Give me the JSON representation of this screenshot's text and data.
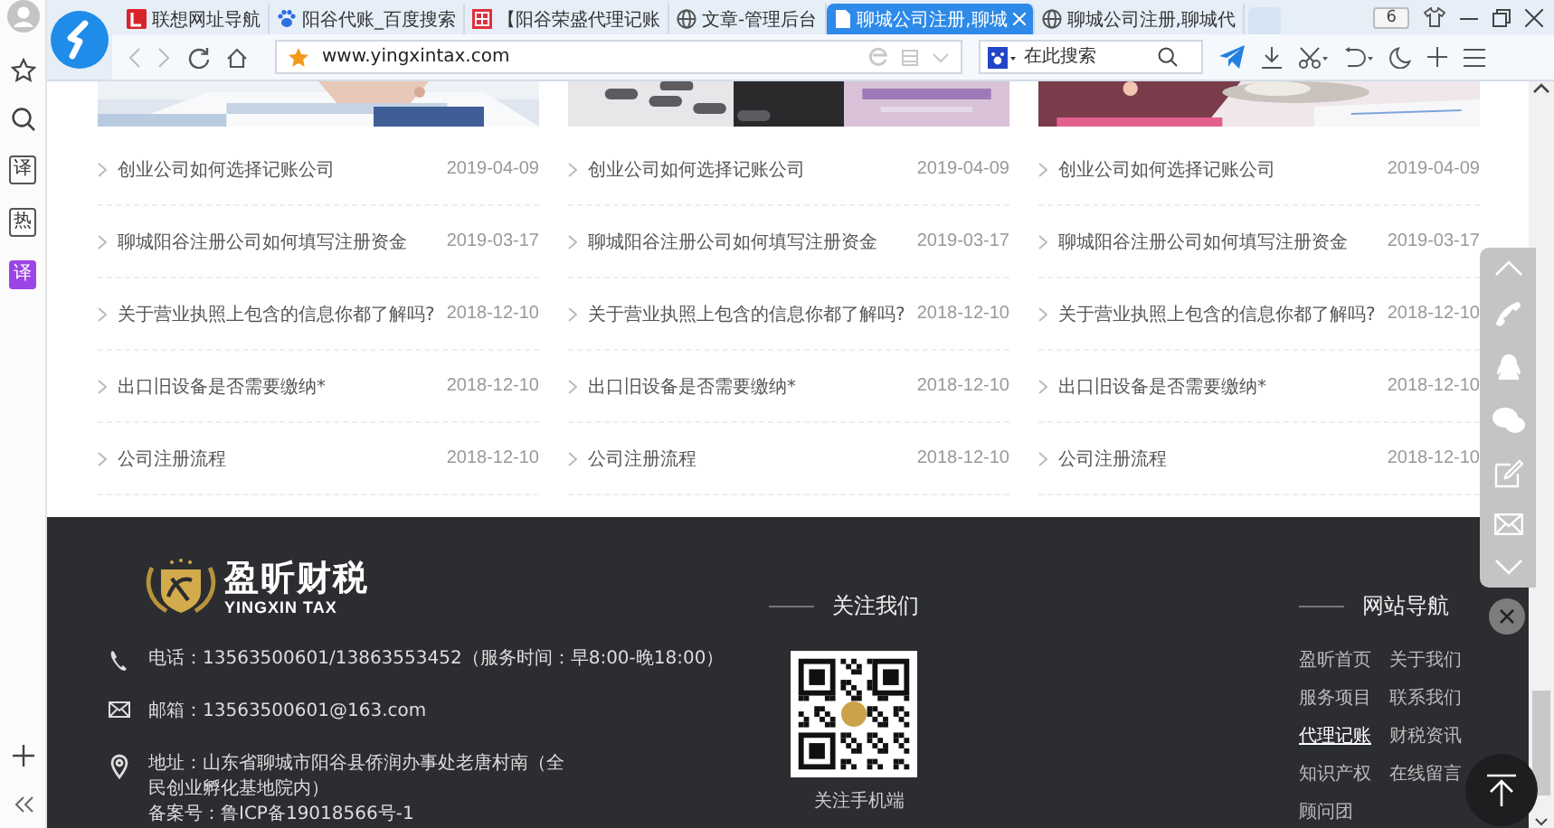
{
  "browser": {
    "tabs": [
      {
        "title": "联想网址导航",
        "kind": "red",
        "selected": false
      },
      {
        "title": "阳谷代账_百度搜索",
        "kind": "paw",
        "selected": false
      },
      {
        "title": "【阳谷荣盛代理记账",
        "kind": "grid",
        "selected": false
      },
      {
        "title": "文章-管理后台",
        "kind": "globe",
        "selected": false
      },
      {
        "title": "聊城公司注册,聊城",
        "kind": "page",
        "selected": true
      },
      {
        "title": "聊城公司注册,聊城代",
        "kind": "globe",
        "selected": false
      }
    ],
    "badge": "6",
    "url": "www.yingxintax.com",
    "search": {
      "placeholder": "在此搜索"
    }
  },
  "sidebar": {
    "tools": [
      {
        "kind": "star"
      },
      {
        "kind": "search"
      },
      {
        "kind": "glyph",
        "text": "译"
      },
      {
        "kind": "glyph",
        "text": "热"
      },
      {
        "kind": "glyph-filled",
        "text": "译"
      }
    ]
  },
  "news": {
    "columns": [
      {
        "image": {
          "kind": "picture"
        },
        "items": [
          {
            "title": "创业公司如何选择记账公司",
            "date": "2019-04-09"
          },
          {
            "title": "聊城阳谷注册公司如何填写注册资金",
            "date": "2019-03-17"
          },
          {
            "title": "关于营业执照上包含的信息你都了解吗?",
            "date": "2018-12-10"
          },
          {
            "title": "出口旧设备是否需要缴纳*",
            "date": "2018-12-10"
          },
          {
            "title": "公司注册流程",
            "date": "2018-12-10"
          }
        ]
      },
      {
        "image": {
          "kind": "picture"
        },
        "items": [
          {
            "title": "创业公司如何选择记账公司",
            "date": "2019-04-09"
          },
          {
            "title": "聊城阳谷注册公司如何填写注册资金",
            "date": "2019-03-17"
          },
          {
            "title": "关于营业执照上包含的信息你都了解吗?",
            "date": "2018-12-10"
          },
          {
            "title": "出口旧设备是否需要缴纳*",
            "date": "2018-12-10"
          },
          {
            "title": "公司注册流程",
            "date": "2018-12-10"
          }
        ]
      },
      {
        "image": {
          "kind": "picture"
        },
        "items": [
          {
            "title": "创业公司如何选择记账公司",
            "date": "2019-04-09"
          },
          {
            "title": "聊城阳谷注册公司如何填写注册资金",
            "date": "2019-03-17"
          },
          {
            "title": "关于营业执照上包含的信息你都了解吗?",
            "date": "2018-12-10"
          },
          {
            "title": "出口旧设备是否需要缴纳*",
            "date": "2018-12-10"
          },
          {
            "title": "公司注册流程",
            "date": "2018-12-10"
          }
        ]
      }
    ]
  },
  "footer": {
    "brand": {
      "name": "盈昕财税",
      "tagline": "YINGXIN TAX"
    },
    "contacts": [
      {
        "kind": "phone",
        "text": "电话：13563500601/13863553452（服务时间：早8:00-晚18:00）"
      },
      {
        "kind": "mail",
        "text": "邮箱：13563500601@163.com"
      },
      {
        "kind": "location",
        "text": "地址：山东省聊城市阳谷县侨润办事处老唐村南（全民创业孵化基地院内）"
      },
      {
        "kind": "plain",
        "text": "备案号：鲁ICP备19018566号-1"
      }
    ],
    "follow": {
      "heading": "关注我们",
      "caption": "关注手机端"
    },
    "nav": {
      "heading": "网站导航",
      "links": [
        {
          "label": "盈昕首页",
          "selected": false
        },
        {
          "label": "关于我们",
          "selected": false
        },
        {
          "label": "服务项目",
          "selected": false
        },
        {
          "label": "联系我们",
          "selected": false
        },
        {
          "label": "代理记账",
          "selected": true
        },
        {
          "label": "财税资讯",
          "selected": false
        },
        {
          "label": "知识产权",
          "selected": false
        },
        {
          "label": "在线留言",
          "selected": false
        },
        {
          "label": "顾问团",
          "selected": false
        }
      ]
    }
  }
}
